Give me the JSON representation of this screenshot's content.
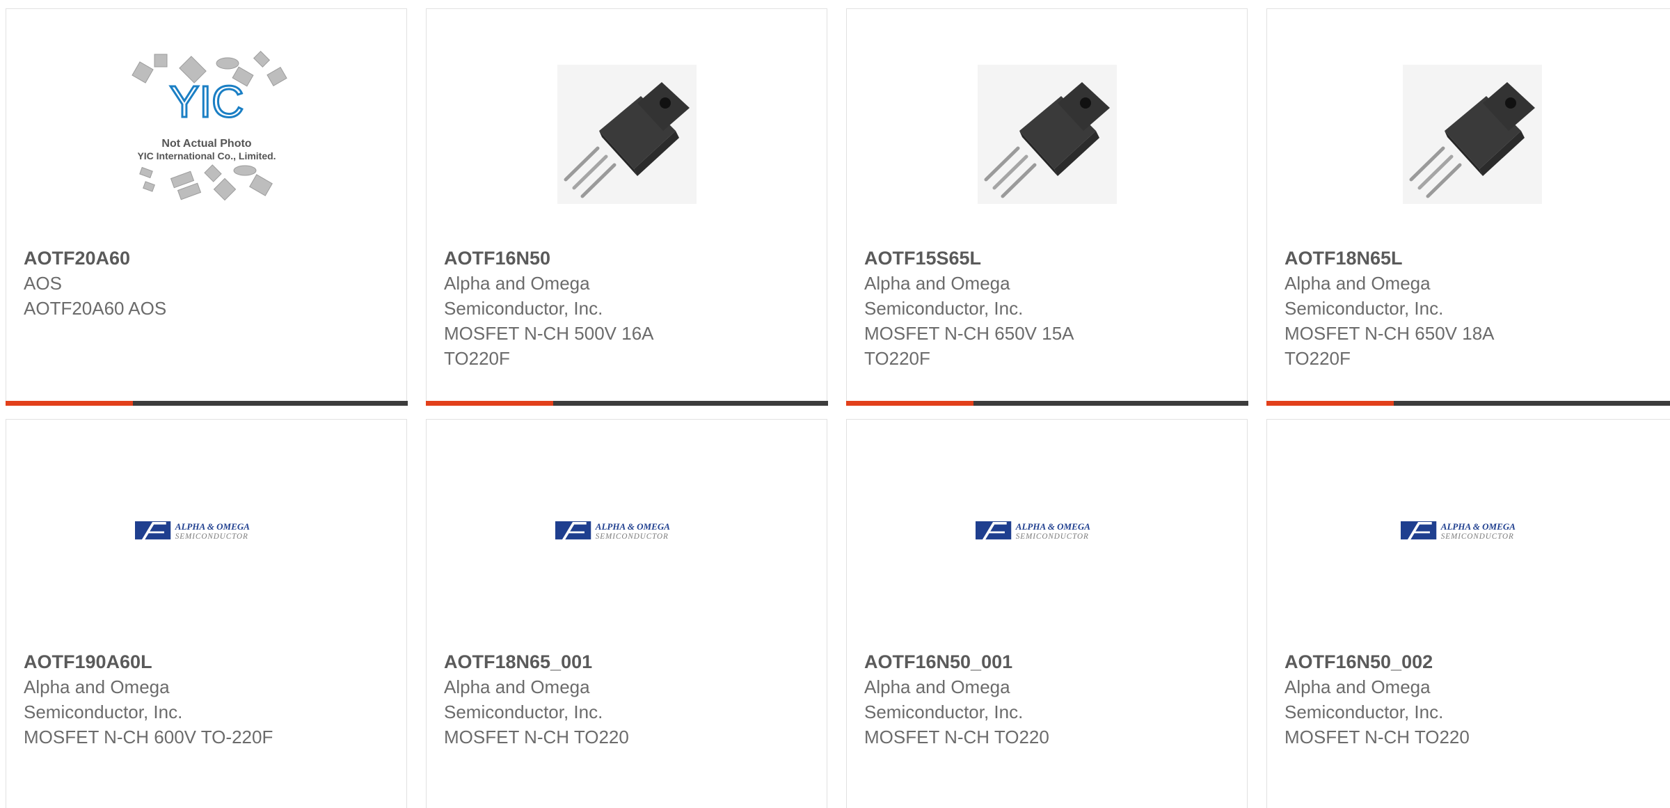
{
  "products": [
    {
      "part_number": "AOTF20A60",
      "manufacturer": "AOS",
      "description": "AOTF20A60 AOS",
      "image": "not-actual-photo-placeholder",
      "image_text": [
        "YIC",
        "Not Actual Photo",
        "YIC International Co., Limited."
      ]
    },
    {
      "part_number": "AOTF16N50",
      "manufacturer": "Alpha and Omega Semiconductor, Inc.",
      "description": "MOSFET N-CH 500V 16A TO220F",
      "image": "to220f-transistor-photo"
    },
    {
      "part_number": "AOTF15S65L",
      "manufacturer": "Alpha and Omega Semiconductor, Inc.",
      "description": "MOSFET N-CH 650V 15A TO220F",
      "image": "to220f-transistor-photo"
    },
    {
      "part_number": "AOTF18N65L",
      "manufacturer": "Alpha and Omega Semiconductor, Inc.",
      "description": "MOSFET N-CH 650V 18A TO220F",
      "image": "to220f-transistor-photo"
    },
    {
      "part_number": "AOTF190A60L",
      "manufacturer": "Alpha and Omega Semiconductor, Inc.",
      "description": "MOSFET N-CH 600V TO-220F",
      "image": "alpha-omega-logo",
      "logo_text": [
        "ALPHA & OMEGA",
        "SEMICONDUCTOR"
      ]
    },
    {
      "part_number": "AOTF18N65_001",
      "manufacturer": "Alpha and Omega Semiconductor, Inc.",
      "description": "MOSFET N-CH TO220",
      "image": "alpha-omega-logo",
      "logo_text": [
        "ALPHA & OMEGA",
        "SEMICONDUCTOR"
      ]
    },
    {
      "part_number": "AOTF16N50_001",
      "manufacturer": "Alpha and Omega Semiconductor, Inc.",
      "description": "MOSFET N-CH TO220",
      "image": "alpha-omega-logo",
      "logo_text": [
        "ALPHA & OMEGA",
        "SEMICONDUCTOR"
      ]
    },
    {
      "part_number": "AOTF16N50_002",
      "manufacturer": "Alpha and Omega Semiconductor, Inc.",
      "description": "MOSFET N-CH TO220",
      "image": "alpha-omega-logo",
      "logo_text": [
        "ALPHA & OMEGA",
        "SEMICONDUCTOR"
      ]
    }
  ],
  "colors": {
    "accent": "#e2401b",
    "bar_dark": "#3c3c3c",
    "card_border": "#e1e1e1",
    "text": "#6b6b6b",
    "logo_blue": "#1f3f8f"
  }
}
